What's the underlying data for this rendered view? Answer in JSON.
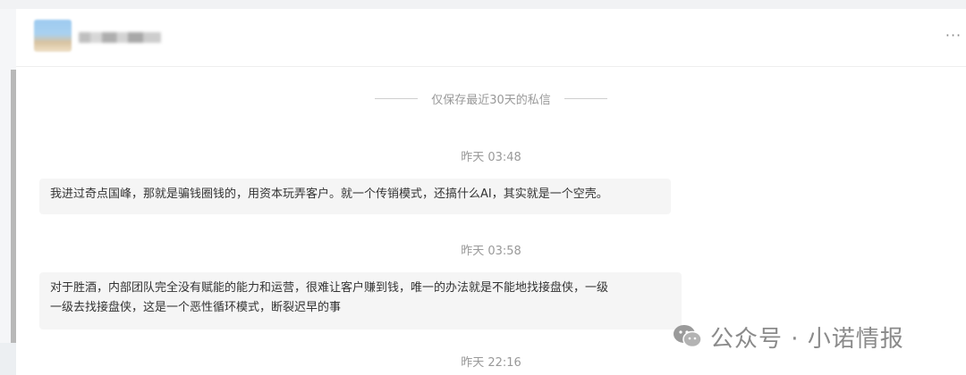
{
  "header": {
    "more_label": "···"
  },
  "notice": {
    "text": "仅保存最近30天的私信"
  },
  "messages": [
    {
      "time": "昨天 03:48",
      "text": "我进过奇点国峰，那就是骗钱圈钱的，用资本玩弄客户。就一个传销模式，还搞什么AI，其实就是一个空壳。"
    },
    {
      "time": "昨天 03:58",
      "line1": "对于胜酒，内部团队完全没有赋能的能力和运营，很难让客户赚到钱，唯一的办法就是不能地找接盘侠，一级",
      "line2": "一级去找接盘侠，这是一个恶性循环模式，断裂迟早的事"
    },
    {
      "time": "昨天 22:16"
    }
  ],
  "watermark": {
    "text": "公众号 · 小诺情报",
    "icon": "wechat-icon"
  },
  "colors": {
    "bubble_bg": "#f5f5f5",
    "meta_text": "#999999",
    "body_text": "#333333"
  }
}
